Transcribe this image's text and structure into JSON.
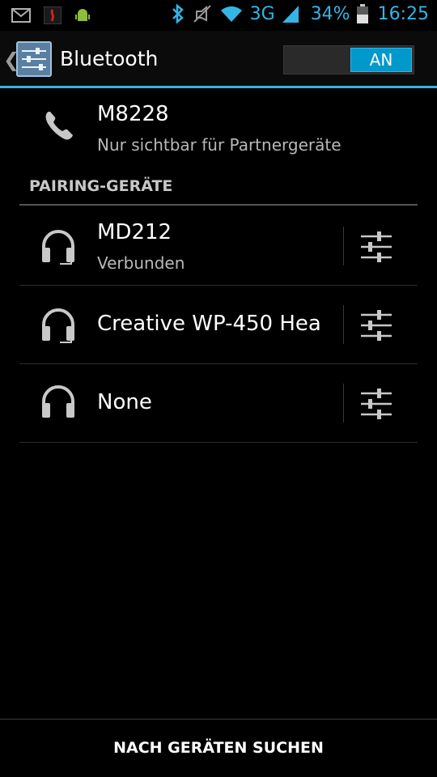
{
  "status_bar": {
    "battery_percent": "34%",
    "network_type": "3G",
    "time": "16:25",
    "accent_color": "#33b5e5",
    "icons": [
      "gmail-icon",
      "app-notification-icon",
      "android-icon",
      "bluetooth-icon",
      "mute-icon",
      "wifi-icon",
      "signal-icon",
      "battery-icon"
    ]
  },
  "action_bar": {
    "title": "Bluetooth",
    "toggle_label": "AN"
  },
  "local_device": {
    "name": "M8228",
    "visibility": "Nur sichtbar für Partnergeräte",
    "icon": "phone-icon"
  },
  "section": {
    "header": "PAIRING-GERÄTE"
  },
  "devices": [
    {
      "name": "MD212",
      "status": "Verbunden",
      "icon": "headset-icon"
    },
    {
      "name": "Creative WP-450 Hea",
      "status": "",
      "icon": "headset-icon"
    },
    {
      "name": "None",
      "status": "",
      "icon": "headset-icon"
    }
  ],
  "footer": {
    "scan_button": "NACH GERÄTEN SUCHEN"
  }
}
